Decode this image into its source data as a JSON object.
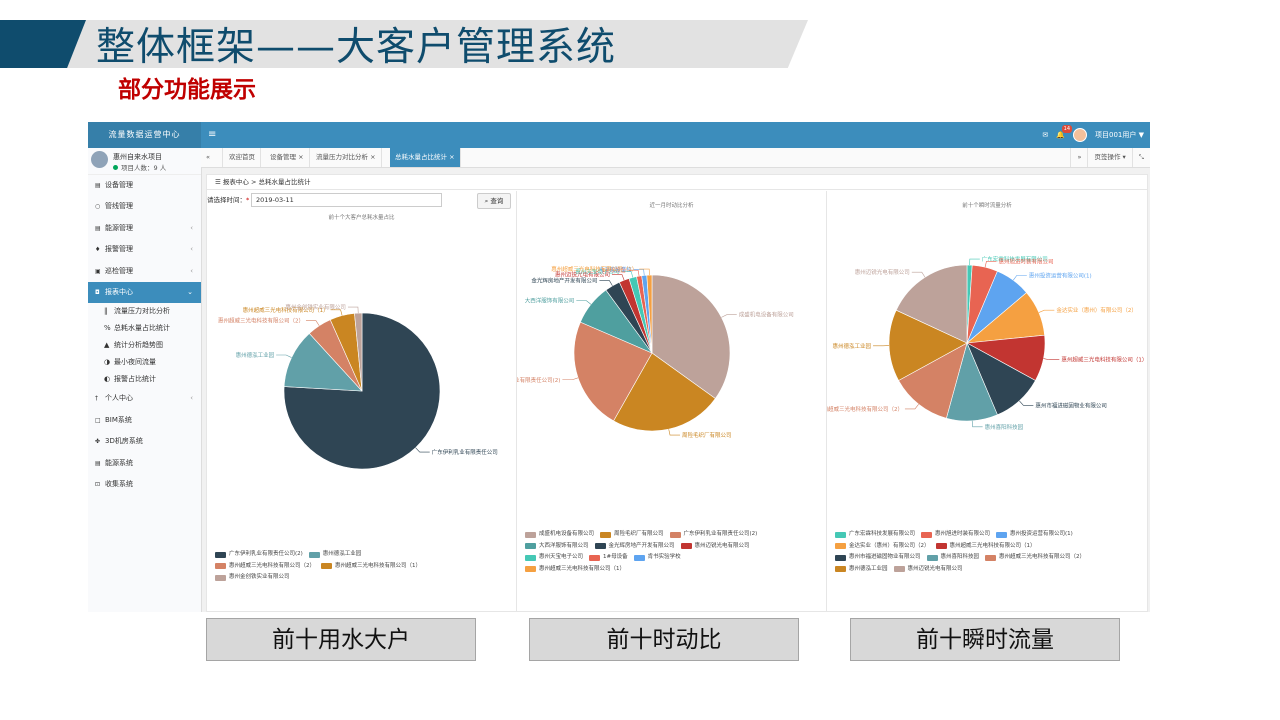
{
  "slide": {
    "title": "整体框架——大客户管理系统",
    "subtitle": "部分功能展示"
  },
  "captions": [
    "前十用水大户",
    "前十时动比",
    "前十瞬时流量"
  ],
  "app": {
    "logo": "流量数据运营中心",
    "menu_icon": "≡",
    "badge": "14",
    "user_menu": "项目001用户 ▼",
    "user": {
      "name": "惠州自来水项目",
      "status": "项目人数：9 人"
    },
    "menu": [
      {
        "icon": "▤",
        "label": "设备管理",
        "arrow": ""
      },
      {
        "icon": "○",
        "label": "管线管理",
        "arrow": ""
      },
      {
        "icon": "▤",
        "label": "能源管理",
        "arrow": "‹"
      },
      {
        "icon": "♦",
        "label": "报警管理",
        "arrow": "‹"
      },
      {
        "icon": "▣",
        "label": "巡检管理",
        "arrow": "‹"
      },
      {
        "icon": "◘",
        "label": "报表中心",
        "arrow": "⌄"
      }
    ],
    "submenu": [
      {
        "icon": "‖",
        "label": "流量压力对比分析"
      },
      {
        "icon": "%",
        "label": "总耗水量占比统计"
      },
      {
        "icon": "▲",
        "label": "统计分析趋势图"
      },
      {
        "icon": "◑",
        "label": "最小夜间流量"
      },
      {
        "icon": "◐",
        "label": "报警占比统计"
      }
    ],
    "menu2": [
      {
        "icon": "†",
        "label": "个人中心",
        "arrow": "‹"
      },
      {
        "icon": "□",
        "label": "BIM系统",
        "arrow": ""
      },
      {
        "icon": "✤",
        "label": "3D机房系统",
        "arrow": ""
      },
      {
        "icon": "▤",
        "label": "能源系统",
        "arrow": ""
      },
      {
        "icon": "⊡",
        "label": "收集系统",
        "arrow": ""
      }
    ],
    "tabs": [
      "欢迎首页",
      "设备管理 ×",
      "流量压力对比分析 ×",
      "总耗水量占比统计 ×"
    ],
    "tabs_left": "«",
    "tabs_right": [
      "»",
      "页签操作 ▾",
      "⤡"
    ],
    "breadcrumb": "☰ 报表中心 > 总耗水量占比统计",
    "filter": {
      "label": "请选择时间：",
      "star": "*",
      "date": "2019-03-11",
      "query": "⌕ 查询"
    }
  },
  "chart_data": [
    {
      "type": "pie",
      "title": "前十个大客户总耗水量占比",
      "labels": [
        "广东伊利乳业有限责任公司",
        "惠州德泓工业园",
        "惠州超威三光电科技有限公司（2）",
        "惠州超威三光电科技有限公司（1）",
        "惠州金创铁实业有限公司"
      ],
      "values": [
        74,
        12,
        5,
        5,
        1.5
      ],
      "colors": [
        "#2f4554",
        "#61a0a8",
        "#d48265",
        "#ca8622",
        "#bda29a"
      ],
      "legend": [
        [
          [
            "广东伊利乳业有限责任公司(2)",
            "#2f4554"
          ],
          [
            "惠州德泓工业园",
            "#61a0a8"
          ]
        ],
        [
          [
            "惠州超威三光电科技有限公司（2）",
            "#d48265"
          ],
          [
            "惠州超威三光电科技有限公司（1）",
            "#ca8622"
          ]
        ],
        [
          [
            "惠州金创铁实业有限公司",
            "#bda29a"
          ]
        ]
      ]
    },
    {
      "type": "pie",
      "title": "近一月时动比分析",
      "labels": [
        "成盛机电设备有限公司",
        "周险毛织厂有限公司",
        "广东伊利乳业有限责任公司(2)",
        "大西洋服饰有限公司",
        "金光辉房地产开发有限公司",
        "惠州迈锐光电有限公司",
        "惠州天宝电子公司",
        "1#母设备",
        "肯书实验学校",
        "惠州超威三光电科技有限公司（1）"
      ],
      "values": [
        33,
        22,
        22,
        8,
        3,
        2,
        1.5,
        1,
        1,
        1
      ],
      "colors": [
        "#bda29a",
        "#ca8622",
        "#d48265",
        "#4f9f9f",
        "#2f4554",
        "#c23531",
        "#45c8b5",
        "#e86452",
        "#5ea4f0",
        "#f5a041"
      ],
      "legend": [
        [
          [
            "成盛机电设备有限公司",
            "#bda29a"
          ],
          [
            "周险毛织厂有限公司",
            "#ca8622"
          ],
          [
            "广东伊利乳业有限责任公司(2)",
            "#d48265"
          ]
        ],
        [
          [
            "大西洋服饰有限公司",
            "#4f9f9f"
          ],
          [
            "金光辉房地产开发有限公司",
            "#2f4554"
          ],
          [
            "惠州迈锐光电有限公司",
            "#c23531"
          ]
        ],
        [
          [
            "惠州天宝电子公司",
            "#45c8b5"
          ],
          [
            "1#母设备",
            "#e86452"
          ],
          [
            "肯书实验学校",
            "#5ea4f0"
          ]
        ],
        [
          [
            "惠州超威三光电科技有限公司（1）",
            "#f5a041"
          ]
        ]
      ]
    },
    {
      "type": "pie",
      "title": "前十个瞬时流量分析",
      "labels": [
        "广东宏霖科技发展有限公司",
        "惠州旭进时装有限公司",
        "惠州投资运营有限公司(1)",
        "金达实业（惠州）有限公司（2）",
        "惠州超威三光电科技有限公司（1）",
        "惠州市福进磁固物业有限公司",
        "惠州喜阳科技园",
        "惠州超威三光电科技有限公司（2）",
        "惠州德泓工业园",
        "惠州迈锐光电有限公司"
      ],
      "values": [
        1,
        5,
        7,
        9,
        9,
        10,
        10,
        12,
        14,
        17
      ],
      "colors": [
        "#45c8b5",
        "#e86452",
        "#5ea4f0",
        "#f5a041",
        "#c23531",
        "#2f4554",
        "#61a0a8",
        "#d48265",
        "#ca8622",
        "#bda29a"
      ],
      "legend": [
        [
          [
            "广东宏霖科技发展有限公司",
            "#45c8b5"
          ],
          [
            "惠州旭进时装有限公司",
            "#e86452"
          ],
          [
            "惠州投资运营有限公司(1)",
            "#5ea4f0"
          ]
        ],
        [
          [
            "金达实业（惠州）有限公司（2）",
            "#f5a041"
          ],
          [
            "惠州超威三光电科技有限公司（1）",
            "#c23531"
          ]
        ],
        [
          [
            "惠州市福进磁固物业有限公司",
            "#2f4554"
          ],
          [
            "惠州喜阳科技园",
            "#61a0a8"
          ],
          [
            "惠州超威三光电科技有限公司（2）",
            "#d48265"
          ]
        ],
        [
          [
            "惠州德泓工业园",
            "#ca8622"
          ],
          [
            "惠州迈锐光电有限公司",
            "#bda29a"
          ]
        ]
      ]
    }
  ]
}
